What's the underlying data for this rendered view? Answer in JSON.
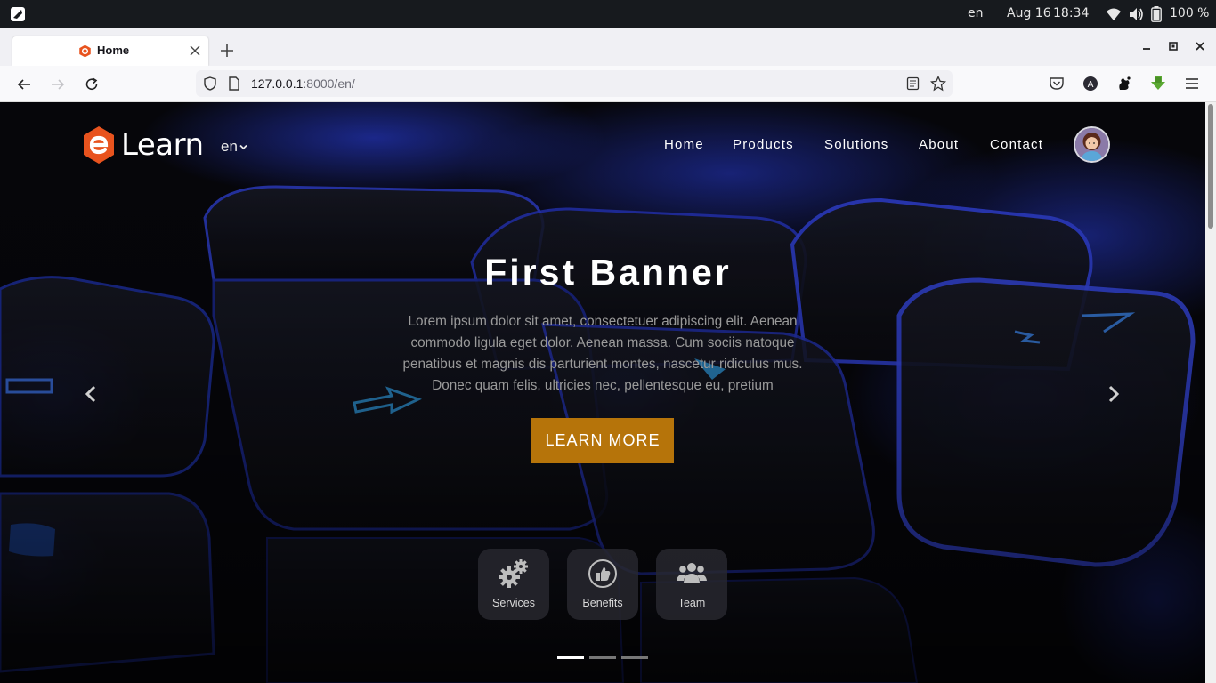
{
  "os": {
    "lang": "en",
    "date": "Aug 16",
    "time": "18:34",
    "battery": "100 %"
  },
  "browser": {
    "tab_title": "Home",
    "url_host": "127.0.0.1",
    "url_path": ":8000/en/"
  },
  "site": {
    "logo_text": "Learn",
    "lang_select": "en",
    "nav": [
      "Home",
      "Products",
      "Solutions",
      "About",
      "Contact"
    ]
  },
  "hero": {
    "title": "First Banner",
    "text": "Lorem ipsum dolor sit amet, consectetuer adipiscing elit. Aenean commodo ligula eget dolor. Aenean massa. Cum sociis natoque penatibus et magnis dis parturient montes, nascetur ridiculus mus. Donec quam felis, ultricies nec, pellentesque eu, pretium",
    "cta": "LEARN MORE",
    "slide_count": 3,
    "active_slide": 1
  },
  "features": [
    {
      "label": "Services",
      "icon": "gears-icon"
    },
    {
      "label": "Benefits",
      "icon": "thumbs-up-icon"
    },
    {
      "label": "Team",
      "icon": "team-icon"
    }
  ],
  "colors": {
    "accent": "#b6740a",
    "logo": "#e8531e",
    "highlight": "#2b3de0"
  }
}
